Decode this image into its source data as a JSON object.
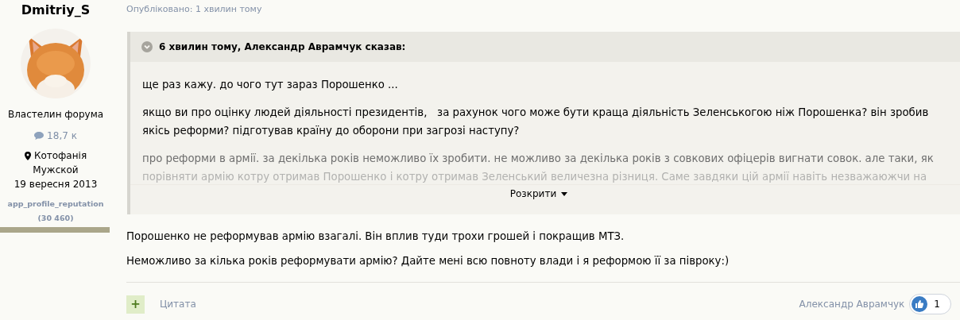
{
  "author": {
    "name": "Dmitriy_S",
    "rank": "Властелин форума",
    "posts": "18,7 к",
    "location": "Котофанія",
    "gender": "Мужской",
    "joined": "19 вересня 2013",
    "reputation_label": "app_profile_reputation",
    "reputation_value": "(30 460)"
  },
  "post": {
    "published": "Опубліковано: 1 хвилин тому",
    "quote": {
      "header": "6 хвилин тому, Александр Аврамчук сказав:",
      "expanded": false,
      "paragraphs": [
        {
          "lines": [
            "ще раз кажу. до чого тут зараз Порошенко ..."
          ]
        },
        {
          "lines": [
            "якщо ви про оцінку людей діяльності президентів,   за рахунок чого може бути краща діяльність Зеленськогою ніж Порошенка? він зробив",
            "якісь реформи? підготував країну до оборони при загрозі наступу?"
          ]
        },
        {
          "lines": [
            "про реформи в армії. за декілька років неможливо їх зробити. не можливо за декілька років з совкових офіцерів вигнати совок. але таки, як",
            "порівняти армію котру отримав Порошенко і котру отримав Зеленський величезна різниця. Саме завдяки цій армії навіть незважаюжчи на"
          ]
        }
      ],
      "expand_label": "Розкрити"
    },
    "body": [
      "Порошенко не реформував армію взагалі. Він вплив туди трохи грошей і покращив МТЗ.",
      "Неможливо за кілька років реформувати армію? Дайте мені всю повноту влади і я реформою її за півроку:)"
    ],
    "footer": {
      "add_label": "+",
      "quote_label": "Цитата",
      "liked_by": "Александр Аврамчук",
      "like_count": "1"
    }
  }
}
